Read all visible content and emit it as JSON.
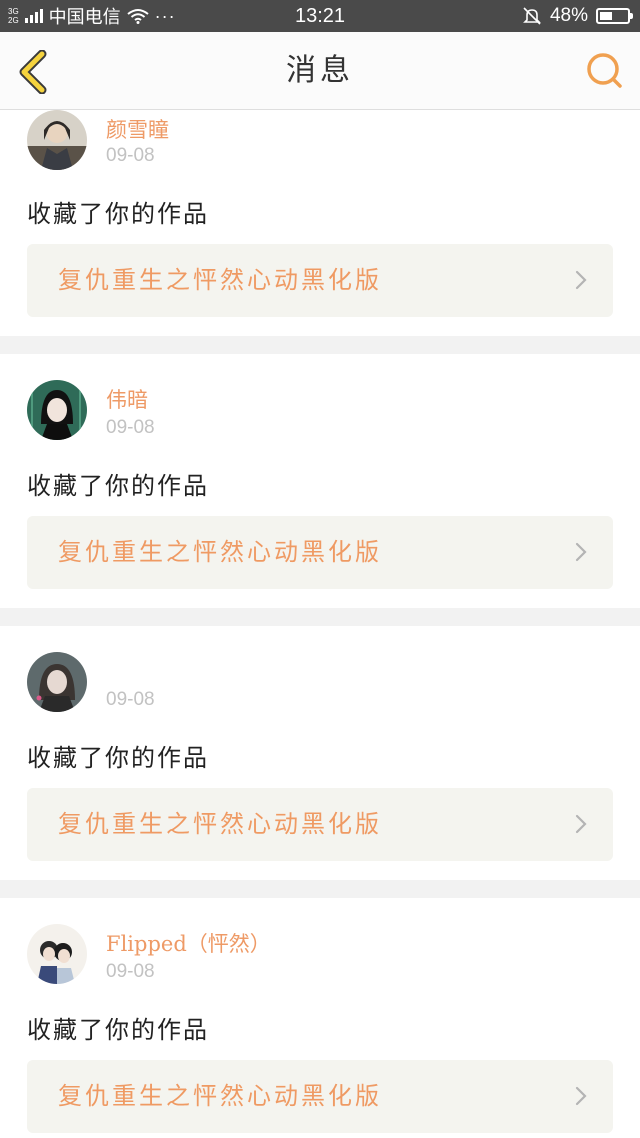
{
  "status_bar": {
    "net_top": "3G",
    "net_bottom": "2G",
    "carrier": "中国电信",
    "dots": "···",
    "time": "13:21",
    "battery": "48%",
    "battery_level": 0.48
  },
  "nav": {
    "title": "消息",
    "back_icon": "chevron-left-icon",
    "search_icon": "search-icon",
    "accent_color": "#f0a050"
  },
  "messages": [
    {
      "username": "颜雪瞳",
      "date": "09-08",
      "action": "收藏了你的作品",
      "work": "复仇重生之怦然心动黑化版"
    },
    {
      "username": "伟暗",
      "date": "09-08",
      "action": "收藏了你的作品",
      "work": "复仇重生之怦然心动黑化版"
    },
    {
      "username": "",
      "date": "09-08",
      "action": "收藏了你的作品",
      "work": "复仇重生之怦然心动黑化版"
    },
    {
      "username": "Flipped（怦然）",
      "date": "09-08",
      "action": "收藏了你的作品",
      "work": "复仇重生之怦然心动黑化版"
    }
  ],
  "colors": {
    "username": "#ee9a66",
    "work_title": "#ef9a63",
    "work_box": "#f4f4ef",
    "separator": "#f2f2f2"
  }
}
